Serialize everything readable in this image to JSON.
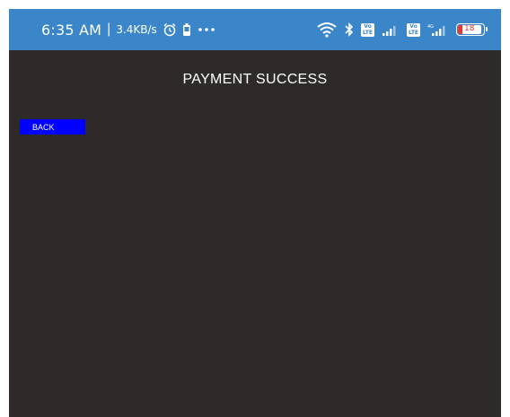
{
  "status_bar": {
    "time": "6:35 AM",
    "separator": "|",
    "speed": "3.4KB/s",
    "battery_level": "18",
    "background_color": "#3a86c8",
    "icons": [
      "alarm-icon",
      "battery-saver-icon",
      "more-dots-icon",
      "wifi-icon",
      "bluetooth-icon",
      "volte-icon",
      "signal-icon"
    ]
  },
  "screen": {
    "title": "PAYMENT SUCCESS",
    "background_color": "#2d2a29"
  },
  "back_button": {
    "label": "BACK",
    "color": "#0000ff"
  }
}
